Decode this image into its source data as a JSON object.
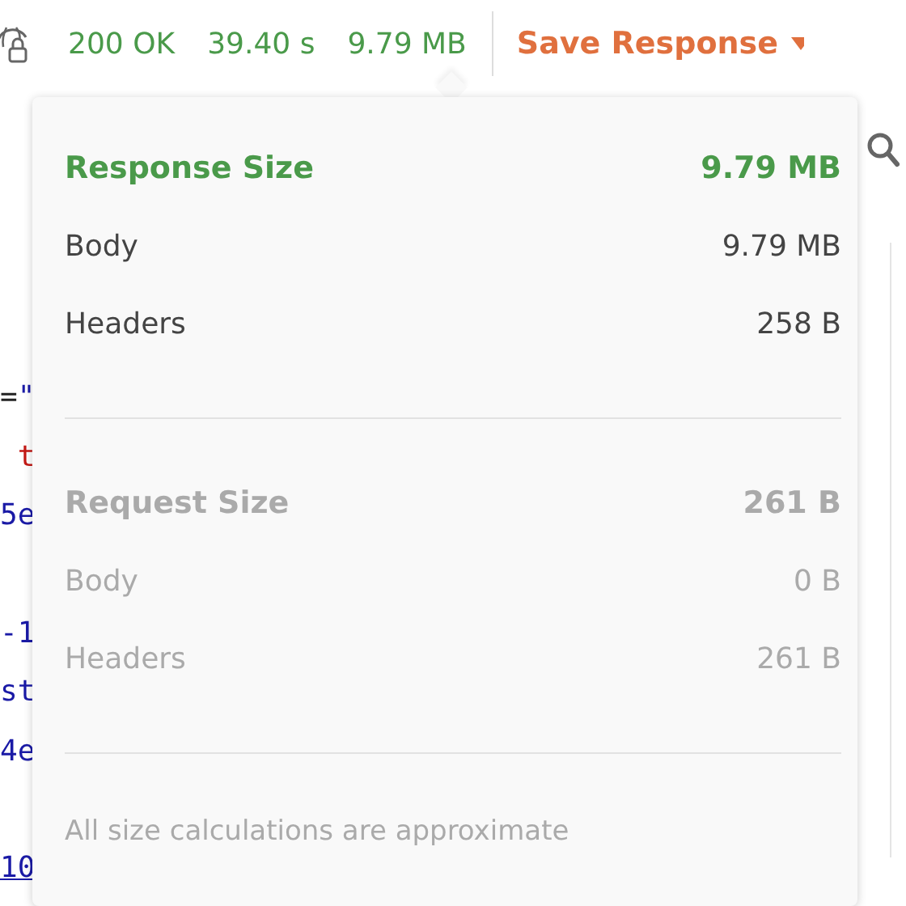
{
  "status_bar": {
    "status": "200 OK",
    "time": "39.40 s",
    "size": "9.79 MB",
    "save_button": "Save Response"
  },
  "code": {
    "blocks": [
      [
        [
          {
            "text": "=",
            "kind": "plain"
          },
          {
            "text": "\"",
            "kind": "string"
          }
        ],
        [
          {
            "text": " t",
            "kind": "key"
          }
        ],
        [
          {
            "text": "5e",
            "kind": "string"
          }
        ]
      ],
      [
        [
          {
            "text": "-1",
            "kind": "string"
          }
        ],
        [
          {
            "text": "st",
            "kind": "string"
          }
        ],
        [
          {
            "text": "4e",
            "kind": "string"
          }
        ]
      ],
      [
        [
          {
            "text": "10",
            "kind": "link"
          }
        ]
      ]
    ]
  },
  "size_popover": {
    "sections": [
      {
        "kind": "response",
        "title": "Response Size",
        "total": "9.79 MB",
        "rows": [
          {
            "label": "Body",
            "value": "9.79 MB"
          },
          {
            "label": "Headers",
            "value": "258 B"
          }
        ]
      },
      {
        "kind": "request",
        "title": "Request Size",
        "total": "261 B",
        "rows": [
          {
            "label": "Body",
            "value": "0 B"
          },
          {
            "label": "Headers",
            "value": "261 B"
          }
        ]
      }
    ],
    "footnote": "All size calculations are approximate"
  }
}
